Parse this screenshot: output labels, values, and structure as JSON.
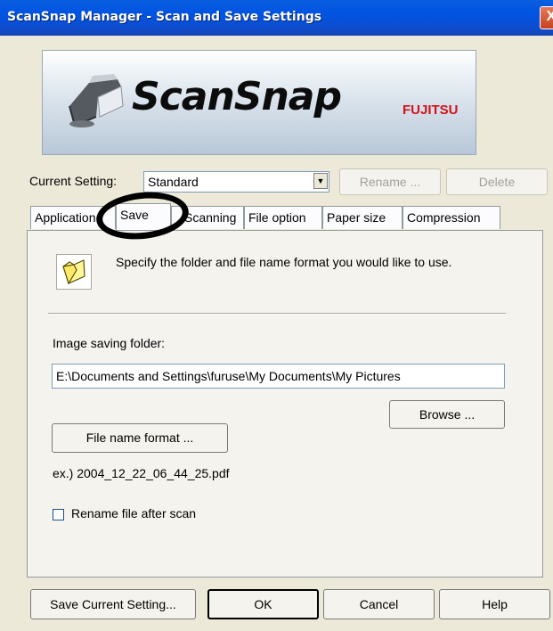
{
  "window": {
    "title": "ScanSnap Manager - Scan and Save Settings",
    "close_glyph": "X"
  },
  "banner": {
    "logo": "ScanSnap",
    "brand": "FUJITSU"
  },
  "current_setting": {
    "label": "Current Setting:",
    "value": "Standard",
    "rename_label": "Rename ...",
    "delete_label": "Delete"
  },
  "tabs": [
    {
      "label": "Application"
    },
    {
      "label": "Save",
      "active": true
    },
    {
      "label": "Scanning"
    },
    {
      "label": "File option"
    },
    {
      "label": "Paper size"
    },
    {
      "label": "Compression"
    }
  ],
  "save": {
    "description": "Specify the folder and file name format you would like to use.",
    "folder_label": "Image saving folder:",
    "folder_value": "E:\\Documents and Settings\\furuse\\My Documents\\My Pictures",
    "browse_label": "Browse ...",
    "file_name_format_label": "File name format ...",
    "example": "ex.) 2004_12_22_06_44_25.pdf",
    "rename_after_scan_label": "Rename file after scan",
    "rename_after_scan_checked": false
  },
  "footer": {
    "save_current_label": "Save Current Setting...",
    "ok_label": "OK",
    "cancel_label": "Cancel",
    "help_label": "Help"
  },
  "icons": {
    "folder": "folder-icon",
    "scanner": "scanner-icon",
    "close": "close-icon",
    "dropdown": "dropdown-arrow-icon"
  },
  "colors": {
    "titlebar": "#0054e3",
    "dialog_bg": "#ece9d8",
    "fujitsu_red": "#d0121b"
  }
}
